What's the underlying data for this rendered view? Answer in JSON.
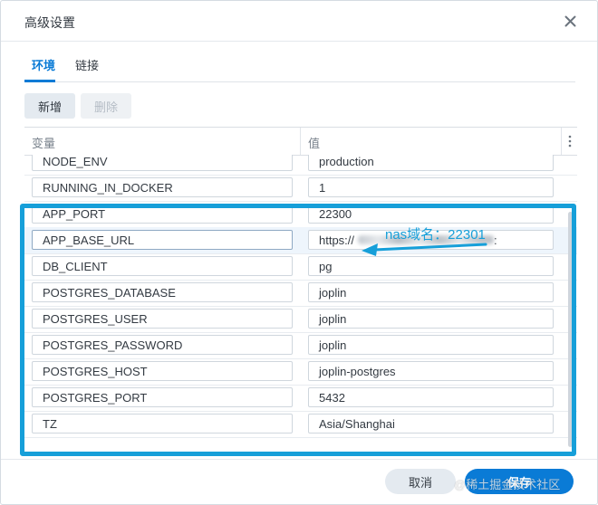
{
  "dialog": {
    "title": "高级设置"
  },
  "tabs": [
    {
      "label": "环境",
      "active": true
    },
    {
      "label": "链接",
      "active": false
    }
  ],
  "toolbar": {
    "add_label": "新增",
    "delete_label": "删除"
  },
  "table": {
    "headers": [
      "变量",
      "值"
    ],
    "rows": [
      {
        "key": "NODE_ENV",
        "value": "production"
      },
      {
        "key": "RUNNING_IN_DOCKER",
        "value": "1"
      },
      {
        "key": "APP_PORT",
        "value": "22300"
      },
      {
        "key": "APP_BASE_URL",
        "value": "https://",
        "value_suffix": ":"
      },
      {
        "key": "DB_CLIENT",
        "value": "pg"
      },
      {
        "key": "POSTGRES_DATABASE",
        "value": "joplin"
      },
      {
        "key": "POSTGRES_USER",
        "value": "joplin"
      },
      {
        "key": "POSTGRES_PASSWORD",
        "value": "joplin"
      },
      {
        "key": "POSTGRES_HOST",
        "value": "joplin-postgres"
      },
      {
        "key": "POSTGRES_PORT",
        "value": "5432"
      },
      {
        "key": "TZ",
        "value": "Asia/Shanghai"
      }
    ]
  },
  "annotation": {
    "text": "nas域名：22301",
    "color": "#169fd9"
  },
  "footer": {
    "cancel_label": "取消",
    "save_label": "保存"
  },
  "watermark": "@稀土掘金技术社区",
  "icons": {
    "close": "close-icon",
    "more": "more-vertical-icon"
  },
  "colors": {
    "accent": "#0a7bd6",
    "highlight": "#169fd9"
  }
}
